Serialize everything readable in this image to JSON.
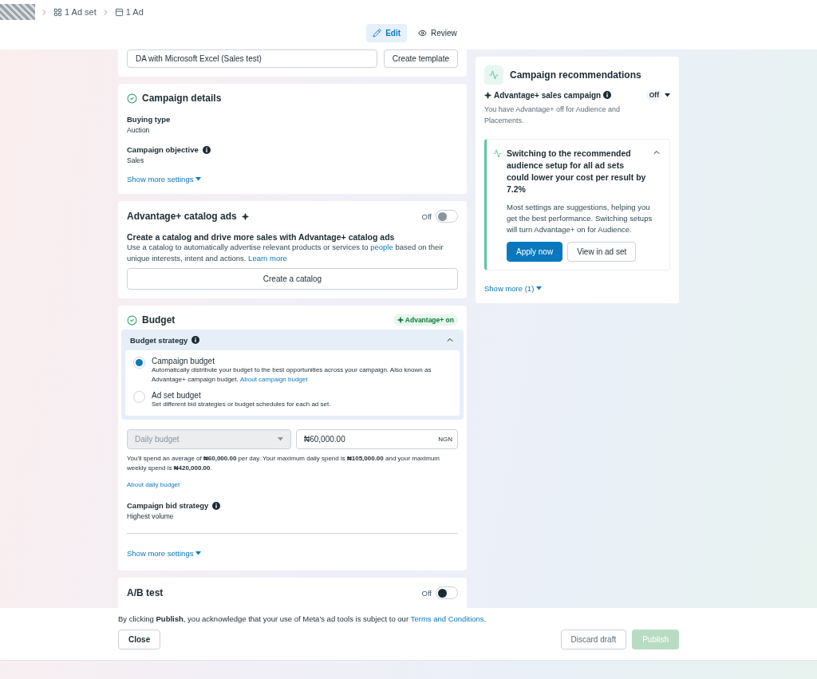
{
  "breadcrumbs": [
    {
      "kind": "adset",
      "label": "1 Ad set"
    },
    {
      "kind": "ad",
      "label": "1 Ad"
    }
  ],
  "mode_tabs": [
    {
      "kind": "edit",
      "label": "Edit",
      "selected": true
    },
    {
      "kind": "review",
      "label": "Review",
      "selected": false
    }
  ],
  "template": {
    "name_value": "DA with Microsoft Excel (Sales test)",
    "button": "Create template"
  },
  "campaign_details": {
    "title": "Campaign details",
    "complete": true,
    "fields": [
      {
        "label": "Buying type",
        "value": "Auction",
        "info": false
      },
      {
        "label": "Campaign objective",
        "value": "Sales",
        "info": true
      }
    ],
    "show_more": "Show more settings"
  },
  "catalog": {
    "title": "Advantage+ catalog ads",
    "toggle_label": "Off",
    "on": false,
    "heading": "Create a catalog and drive more sales with Advantage+ catalog ads",
    "text_before": "Use a catalog to automatically advertise relevant products or services to",
    "link": "people",
    "text_after": "based on their unique interests, intent and actions.",
    "learn_more": "Learn more",
    "button": "Create a catalog"
  },
  "budget": {
    "title": "Budget",
    "complete": true,
    "badge": "Advantage+ on",
    "strategy": {
      "title": "Budget strategy",
      "expanded": true,
      "options": [
        {
          "label": "Campaign budget",
          "description": "Automatically distribute your budget to the best opportunities across your campaign. Also known as Advantage+ campaign budget.",
          "link": "About campaign budget",
          "selected": true
        },
        {
          "label": "Ad set budget",
          "description": "Set different bid strategies or budget schedules for each ad set.",
          "selected": false
        }
      ]
    },
    "budget_type": {
      "value": "Daily budget",
      "disabled": true
    },
    "amount": {
      "value": "₦60,000.00",
      "currency": "NGN"
    },
    "note": "You'll spend an average of **₦60,000.00** per day. Your maximum daily spend is **₦105,000.00** and your maximum weekly spend is **₦420,000.00**.",
    "note_link": "About daily budget",
    "bid_strategy": {
      "label": "Campaign bid strategy",
      "value": "Highest volume"
    },
    "show_more": "Show more settings"
  },
  "ab_test": {
    "title": "A/B test",
    "toggle_label": "Off",
    "on": false
  },
  "recommendations": {
    "title": "Campaign recommendations",
    "advantage": {
      "label": "Advantage+ sales campaign",
      "status": "Off"
    },
    "note": "You have Advantage+ off for Audience and Placements.",
    "card": {
      "title": "Switching to the recommended audience setup for all ad sets could lower your cost per result by 7.2%",
      "expanded": true,
      "body": "Most settings are suggestions, helping you get the best performance. Switching setups will turn Advantage+ on for Audience.",
      "buttons": [
        {
          "label": "Apply now",
          "primary": true
        },
        {
          "label": "View in ad set",
          "primary": false
        }
      ]
    },
    "show_more": "Show more (1)"
  },
  "footer": {
    "notice_before": "By clicking **Publish**, you acknowledge that your use of Meta's ad tools is subject to our",
    "notice_link": "Terms and Conditions",
    "notice_after": ".",
    "close": "Close",
    "discard": "Discard draft",
    "publish": {
      "label": "Publish",
      "disabled": true
    }
  }
}
